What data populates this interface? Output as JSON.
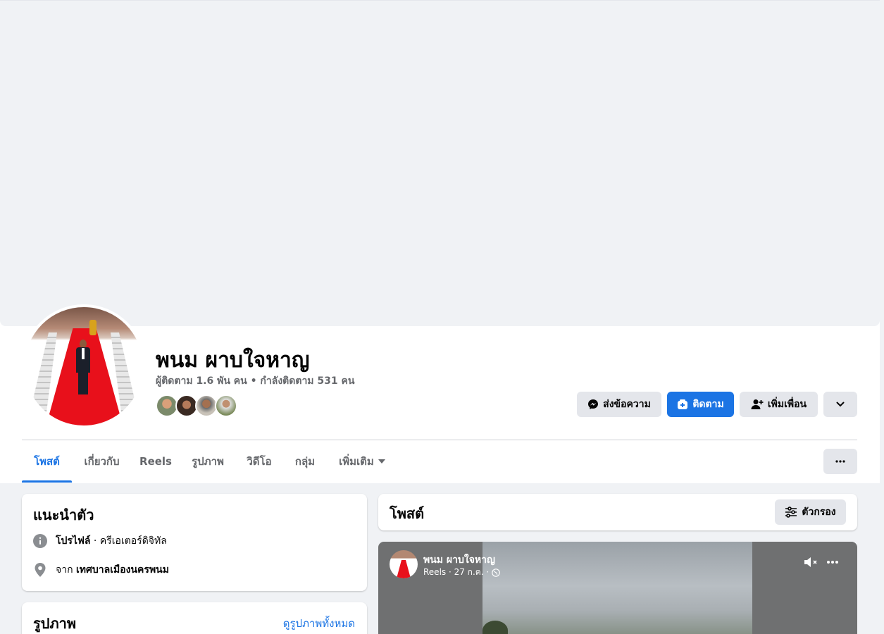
{
  "profile": {
    "name": "พนม ผาบใจหาญ",
    "stats": "ผู้ติดตาม 1.6 พัน คน • กำลังติดตาม 531 คน"
  },
  "actions": {
    "message_label": "ส่งข้อความ",
    "follow_label": "ติดตาม",
    "add_friend_label": "เพิ่มเพื่อน"
  },
  "tabs": [
    {
      "label": "โพสต์",
      "active": true
    },
    {
      "label": "เกี่ยวกับ"
    },
    {
      "label": "Reels"
    },
    {
      "label": "รูปภาพ"
    },
    {
      "label": "วิดีโอ"
    },
    {
      "label": "กลุ่ม"
    },
    {
      "label": "เพิ่มเติม"
    }
  ],
  "intro": {
    "title": "แนะนำตัว",
    "profile_prefix": "โปรไฟล์",
    "profile_suffix": " · ครีเอเตอร์ดิจิทัล",
    "from_prefix": "จาก ",
    "from_place": "เทศบาลเมืองนครพนม"
  },
  "photos": {
    "title": "รูปภาพ",
    "see_all": "ดูรูปภาพทั้งหมด"
  },
  "posts": {
    "title": "โพสต์",
    "filter_label": "ตัวกรอง"
  },
  "reel_post": {
    "author": "พนม ผาบใจหาญ",
    "meta": "Reels · 27 ก.ค. ·"
  },
  "colors": {
    "accent": "#1b74e4",
    "background": "#f0f2f5",
    "secondary_text": "#65676b"
  },
  "icons": {
    "message": "messenger-icon",
    "follow": "follow-plus-icon",
    "add_friend": "person-add-icon",
    "more": "chevron-down-icon",
    "info": "info-icon",
    "location": "location-pin-icon",
    "filter": "sliders-icon",
    "globe": "globe-icon",
    "mute": "muted-speaker-icon",
    "dots": "more-dots-icon"
  }
}
